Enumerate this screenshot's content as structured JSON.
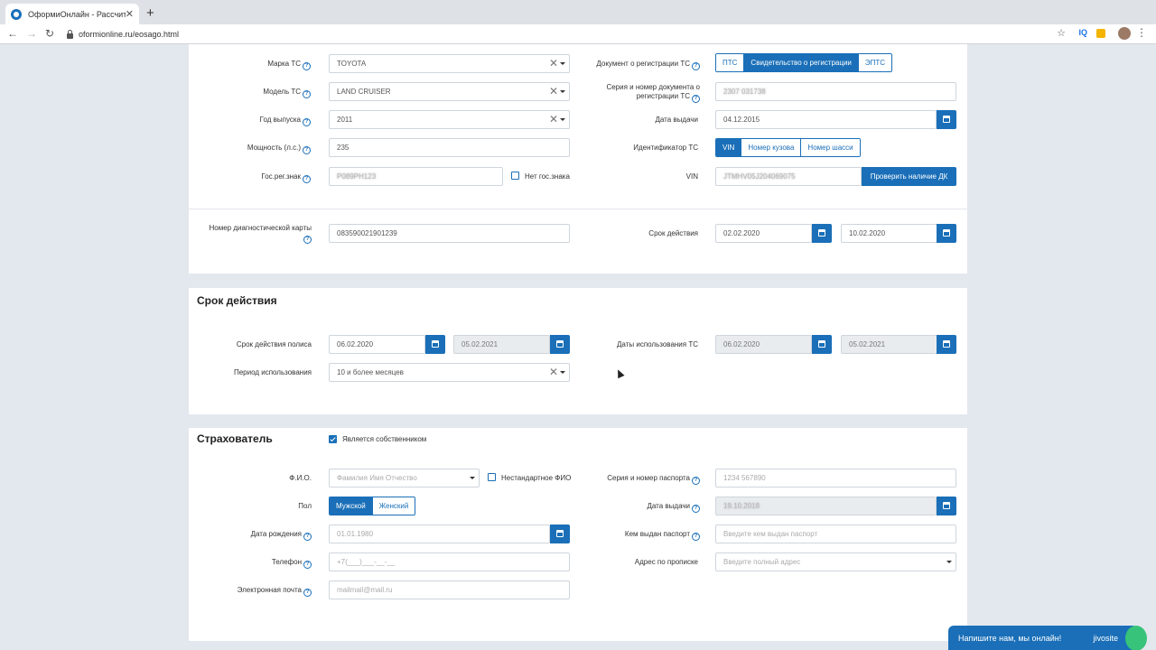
{
  "browser": {
    "tab_title": "ОформиОнлайн - Рассчитать",
    "tab_close": "✕",
    "new_tab": "+",
    "back": "←",
    "forward": "→",
    "reload": "↻",
    "url": "oformionline.ru/eosago.html",
    "star": "☆",
    "ext_iq": "IQ",
    "menu": "⋮"
  },
  "vehicle": {
    "brand_label": "Марка ТС",
    "brand_value": "TOYOTA",
    "model_label": "Модель ТС",
    "model_value": "LAND CRUISER",
    "year_label": "Год выпуска",
    "year_value": "2011",
    "power_label": "Мощность (л.с.)",
    "power_value": "235",
    "plate_label": "Гос.рег.знак",
    "plate_value": "Р089РН123",
    "no_plate_label": "Нет гос.знака",
    "doc_label": "Документ о регистрации ТС",
    "doc_options": [
      "ПТС",
      "Свидетельство о регистрации",
      "ЭПТС"
    ],
    "doc_selected": "Свидетельство о регистрации",
    "doc_number_label": "Серия и номер документа о регистрации ТС",
    "doc_number_value": "2307 031738",
    "issue_date_label": "Дата выдачи",
    "issue_date_value": "04.12.2015",
    "id_label": "Идентификатор ТС",
    "id_options": [
      "VIN",
      "Номер кузова",
      "Номер шасси"
    ],
    "id_selected": "VIN",
    "vin_label": "VIN",
    "vin_value": "JTMHV05J204069075",
    "check_dk_button": "Проверить наличие ДК"
  },
  "diagnostic": {
    "card_label": "Номер диагностической карты",
    "card_value": "083590021901239",
    "validity_label": "Срок действия",
    "from": "02.02.2020",
    "to": "10.02.2020"
  },
  "policy": {
    "title": "Срок действия",
    "term_label": "Срок действия полиса",
    "term_from": "06.02.2020",
    "term_to": "05.02.2021",
    "usage_dates_label": "Даты использования ТС",
    "usage_from": "06.02.2020",
    "usage_to": "05.02.2021",
    "period_label": "Период использования",
    "period_value": "10 и более месяцев"
  },
  "insurer": {
    "title": "Страхователь",
    "is_owner_label": "Является собственником",
    "fio_label": "Ф.И.О.",
    "fio_placeholder": "Фамилия Имя Отчество",
    "nonstandard_fio_label": "Нестандартное ФИО",
    "gender_label": "Пол",
    "gender_options": [
      "Мужской",
      "Женский"
    ],
    "gender_selected": "Мужской",
    "birth_label": "Дата рождения",
    "birth_placeholder": "01.01.1980",
    "phone_label": "Телефон",
    "phone_placeholder": "+7(___)___-__-__",
    "email_label": "Электронная почта",
    "email_placeholder": "mailmail@mail.ru",
    "passport_label": "Серия и номер паспорта",
    "passport_placeholder": "1234 567890",
    "passport_date_label": "Дата выдачи",
    "passport_date_value": "19.10.2018",
    "issued_by_label": "Кем выдан паспорт",
    "issued_by_placeholder": "Введите кем выдан паспорт",
    "address_label": "Адрес по прописке",
    "address_placeholder": "Введите полный адрес"
  },
  "chat": {
    "text": "Напишите нам, мы онлайн!",
    "brand": "jivosite"
  },
  "colors": {
    "primary": "#1a6fb8",
    "page_bg": "#e3e8ee",
    "chat_dot": "#37c37a"
  }
}
